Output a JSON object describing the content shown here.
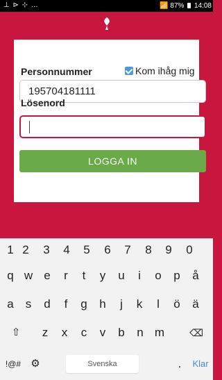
{
  "statusbar": {
    "left_icons": "⊥ ⊳ ⊹ …",
    "signal": "☷ .∢l",
    "battery": "87%",
    "time": "14:08"
  },
  "app": {
    "logo_icon": "heart-leaf-logo",
    "accent": "#c8163f"
  },
  "form": {
    "personnummer_label": "Personnummer",
    "remember_label": "Kom ihåg mig",
    "remember_checked": true,
    "personnummer_value": "195704181111",
    "losenord_label": "Lösenord",
    "losenord_value": "",
    "login_button": "LOGGA IN"
  },
  "keyboard": {
    "row_numbers": [
      "1",
      "2",
      "3",
      "4",
      "5",
      "6",
      "7",
      "8",
      "9",
      "0"
    ],
    "row1": [
      "q",
      "w",
      "e",
      "r",
      "t",
      "y",
      "u",
      "i",
      "o",
      "p",
      "å"
    ],
    "row2": [
      "a",
      "s",
      "d",
      "f",
      "g",
      "h",
      "j",
      "k",
      "l",
      "ö",
      "ä"
    ],
    "row3": [
      "z",
      "x",
      "c",
      "v",
      "b",
      "n",
      "m"
    ],
    "symbols_key": "!@#",
    "space_label": "Svenska",
    "period_key": ".",
    "enter_label": "Klar"
  }
}
